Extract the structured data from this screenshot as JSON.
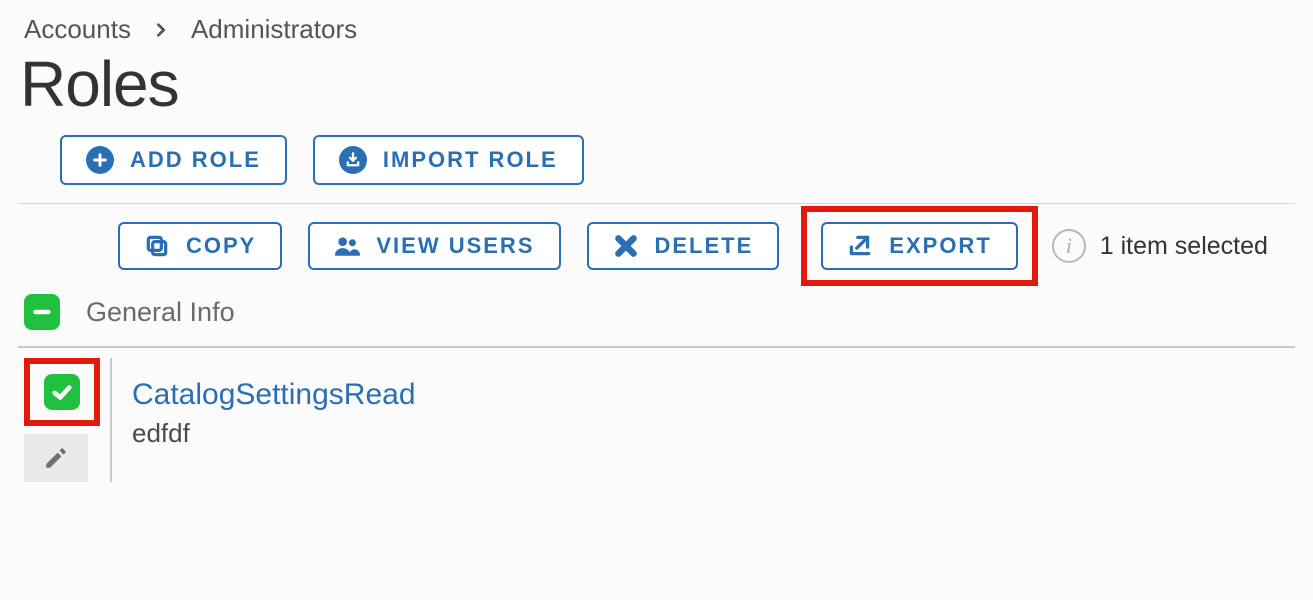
{
  "breadcrumb": {
    "root": "Accounts",
    "current": "Administrators"
  },
  "title": "Roles",
  "primary_toolbar": {
    "add_role": "ADD ROLE",
    "import_role": "IMPORT ROLE"
  },
  "selection_toolbar": {
    "copy": "COPY",
    "view_users": "VIEW USERS",
    "delete": "DELETE",
    "export": "EXPORT",
    "selected_text": "1 item selected"
  },
  "columns": {
    "general_info": "General Info"
  },
  "rows": [
    {
      "name": "CatalogSettingsRead",
      "description": "edfdf",
      "checked": true
    }
  ],
  "colors": {
    "accent": "#2a6fb5",
    "highlight": "#e11a0c",
    "check_green": "#1fc13f"
  }
}
